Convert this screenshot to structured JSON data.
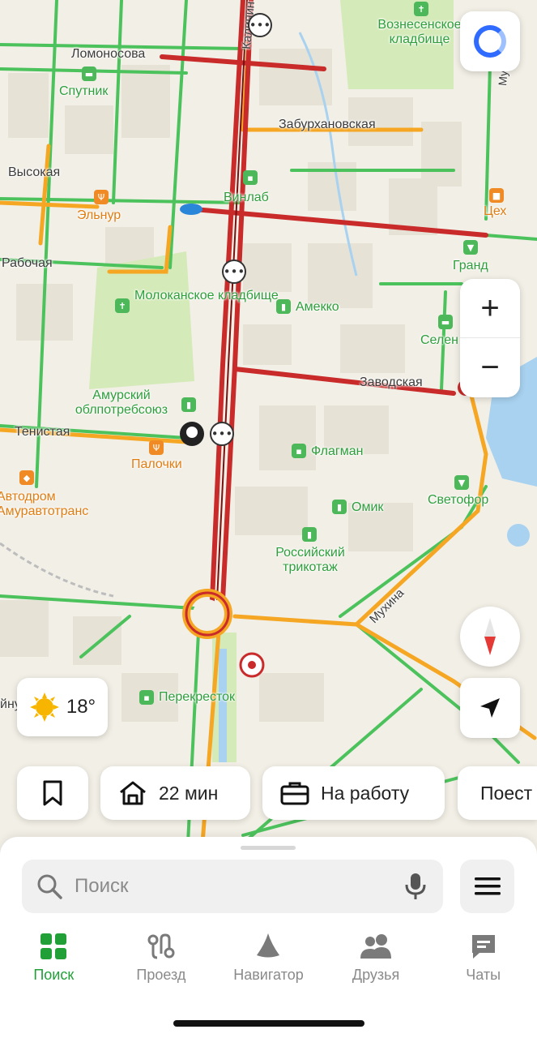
{
  "map": {
    "streets": [
      "Ломоносова",
      "Калинин",
      "Забурхановская",
      "Высокая",
      "Рабочая",
      "Тенистая",
      "Заводская",
      "Мухина",
      "Му",
      "йну"
    ],
    "pois": {
      "voznesenskoe": "Вознесенское кладбище",
      "sputnik": "Спутник",
      "vinlab": "Винлаб",
      "elnur": "Эльнур",
      "tseh": "Цех",
      "grand": "Гранд",
      "molokanskoe": "Молоканское кладбище",
      "amekko": "Амекко",
      "selena": "Селен",
      "amursky": "Амурский облпотребсоюз",
      "palochki": "Палочки",
      "flagman": "Флагман",
      "avtodrom": "Автодром Амуравтотранс",
      "svetofor": "Светофор",
      "omik": "Омик",
      "trikotazh": "Российский трикотаж",
      "perekrestok": "Перекресток"
    },
    "colors": {
      "jam": "#c92a2a",
      "slow": "#f5a623",
      "free": "#4cc25c",
      "water": "#a8d2f0",
      "park": "#d4eab8"
    }
  },
  "weather": {
    "temperature": "18°",
    "icon": "sun-icon"
  },
  "controls": {
    "zoom_in": "+",
    "zoom_out": "−"
  },
  "chips": [
    {
      "icon": "bookmark-icon",
      "label": ""
    },
    {
      "icon": "home-icon",
      "label": "22 мин"
    },
    {
      "icon": "briefcase-icon",
      "label": "На работу"
    },
    {
      "icon": "",
      "label": "Поест"
    }
  ],
  "search": {
    "placeholder": "Поиск"
  },
  "tabs": [
    {
      "label": "Поиск",
      "icon": "grid-icon",
      "active": true
    },
    {
      "label": "Проезд",
      "icon": "transit-icon",
      "active": false
    },
    {
      "label": "Навигатор",
      "icon": "navigator-icon",
      "active": false
    },
    {
      "label": "Друзья",
      "icon": "friends-icon",
      "active": false
    },
    {
      "label": "Чаты",
      "icon": "chat-icon",
      "active": false
    }
  ]
}
